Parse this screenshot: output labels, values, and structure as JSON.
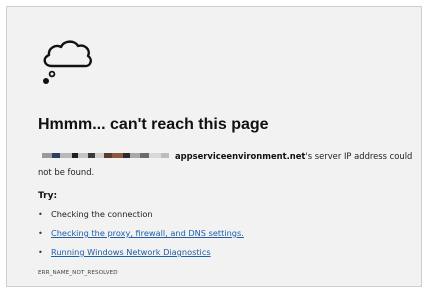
{
  "error_page": {
    "headline": "Hmmm... can't reach this page",
    "message": {
      "host": "appserviceenvironment.net",
      "text": "'s server IP address could not be found."
    },
    "try_heading": "Try:",
    "suggestions": [
      {
        "label": "Checking the connection",
        "is_link": false
      },
      {
        "label": "Checking the proxy, firewall, and DNS settings.",
        "is_link": true
      },
      {
        "label": "Running Windows Network Diagnostics",
        "is_link": true
      }
    ],
    "error_code": "ERR_NAME_NOT_RESOLVED"
  },
  "icons": {
    "hero": "thought-cloud-icon"
  },
  "colors": {
    "background": "#f2f2f2",
    "text": "#222222",
    "link": "#1f5fa8"
  }
}
